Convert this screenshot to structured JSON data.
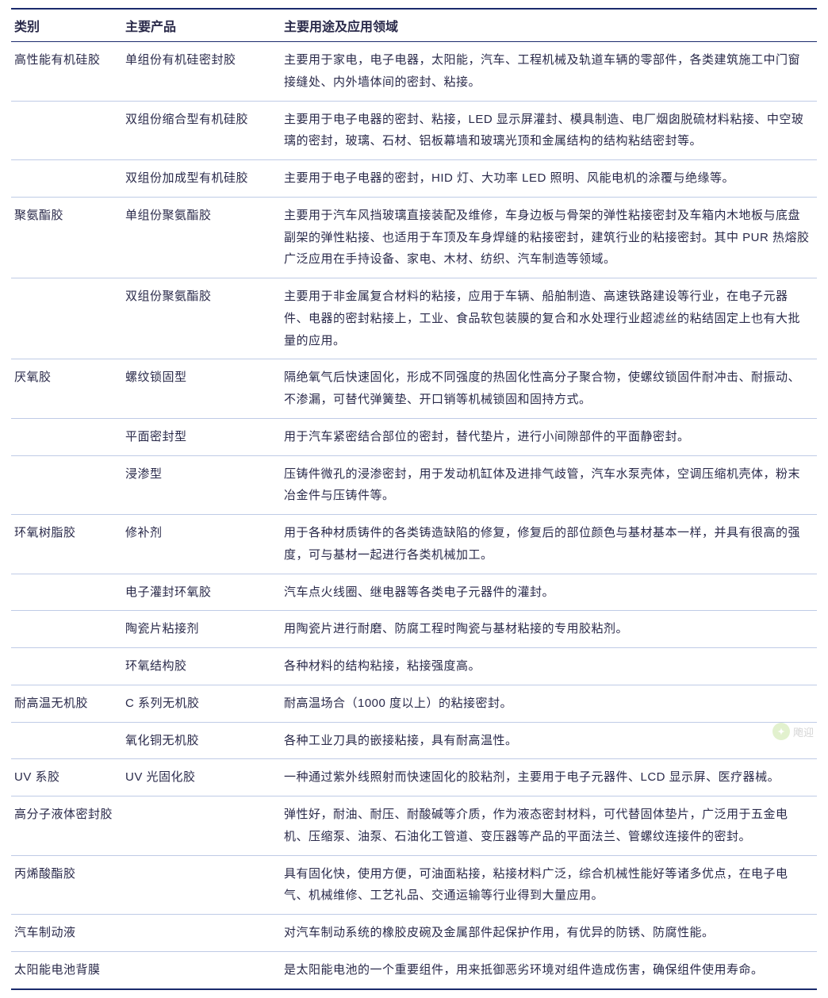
{
  "headers": {
    "c1": "类别",
    "c2": "主要产品",
    "c3": "主要用途及应用领域"
  },
  "rows": [
    {
      "cat": "高性能有机硅胶",
      "prod": "单组份有机硅密封胶",
      "use": "主要用于家电，电子电器，太阳能，汽车、工程机械及轨道车辆的零部件，各类建筑施工中门窗接缝处、内外墙体间的密封、粘接。"
    },
    {
      "cat": "",
      "prod": "双组份缩合型有机硅胶",
      "use": "主要用于电子电器的密封、粘接，LED 显示屏灌封、模具制造、电厂烟囱脱硫材料粘接、中空玻璃的密封，玻璃、石材、铝板幕墙和玻璃光顶和金属结构的结构粘结密封等。"
    },
    {
      "cat": "",
      "prod": "双组份加成型有机硅胶",
      "use": "主要用于电子电器的密封，HID 灯、大功率 LED 照明、风能电机的涂覆与绝缘等。"
    },
    {
      "cat": "聚氨酯胶",
      "prod": "单组份聚氨酯胶",
      "use": "主要用于汽车风挡玻璃直接装配及维修，车身边板与骨架的弹性粘接密封及车箱内木地板与底盘副架的弹性粘接、也适用于车顶及车身焊缝的粘接密封，建筑行业的粘接密封。其中 PUR 热熔胶广泛应用在手持设备、家电、木材、纺织、汽车制造等领域。"
    },
    {
      "cat": "",
      "prod": "双组份聚氨酯胶",
      "use": "主要用于非金属复合材料的粘接，应用于车辆、船舶制造、高速铁路建设等行业，在电子元器件、电器的密封粘接上，工业、食品软包装膜的复合和水处理行业超滤丝的粘结固定上也有大批量的应用。"
    },
    {
      "cat": "厌氧胶",
      "prod": "螺纹锁固型",
      "use": "隔绝氧气后快速固化，形成不同强度的热固化性高分子聚合物，使螺纹锁固件耐冲击、耐振动、不渗漏，可替代弹簧垫、开口销等机械锁固和固持方式。"
    },
    {
      "cat": "",
      "prod": "平面密封型",
      "use": "用于汽车紧密结合部位的密封，替代垫片，进行小间隙部件的平面静密封。"
    },
    {
      "cat": "",
      "prod": "浸渗型",
      "use": "压铸件微孔的浸渗密封，用于发动机缸体及进排气歧管，汽车水泵壳体，空调压缩机壳体，粉末冶金件与压铸件等。"
    },
    {
      "cat": "环氧树脂胶",
      "prod": "修补剂",
      "use": "用于各种材质铸件的各类铸造缺陷的修复，修复后的部位颜色与基材基本一样，并具有很高的强度，可与基材一起进行各类机械加工。"
    },
    {
      "cat": "",
      "prod": "电子灌封环氧胶",
      "use": "汽车点火线圈、继电器等各类电子元器件的灌封。"
    },
    {
      "cat": "",
      "prod": "陶瓷片粘接剂",
      "use": "用陶瓷片进行耐磨、防腐工程时陶瓷与基材粘接的专用胶粘剂。"
    },
    {
      "cat": "",
      "prod": "环氧结构胶",
      "use": "各种材料的结构粘接，粘接强度高。"
    },
    {
      "cat": "耐高温无机胶",
      "prod": "C 系列无机胶",
      "use": "耐高温场合（1000 度以上）的粘接密封。"
    },
    {
      "cat": "",
      "prod": "氧化铜无机胶",
      "use": "各种工业刀具的嵌接粘接，具有耐高温性。"
    },
    {
      "cat": "UV 系胶",
      "prod": "UV 光固化胶",
      "use": "一种通过紫外线照射而快速固化的胶粘剂，主要用于电子元器件、LCD 显示屏、医疗器械。"
    },
    {
      "cat": "高分子液体密封胶",
      "prod": "",
      "use": "弹性好，耐油、耐压、耐酸碱等介质，作为液态密封材料，可代替固体垫片，广泛用于五金电机、压缩泵、油泵、石油化工管道、变压器等产品的平面法兰、管螺纹连接件的密封。"
    },
    {
      "cat": "丙烯酸酯胶",
      "prod": "",
      "use": "具有固化快，使用方便，可油面粘接，粘接材料广泛，综合机械性能好等诸多优点，在电子电气、机械维修、工艺礼品、交通运输等行业得到大量应用。"
    },
    {
      "cat": "汽车制动液",
      "prod": "",
      "use": "对汽车制动系统的橡胶皮碗及金属部件起保护作用，有优异的防锈、防腐性能。"
    },
    {
      "cat": "太阳能电池背膜",
      "prod": "",
      "use": "是太阳能电池的一个重要组件，用来抵御恶劣环境对组件造成伤害，确保组件使用寿命。"
    }
  ],
  "watermark": "飑迎"
}
